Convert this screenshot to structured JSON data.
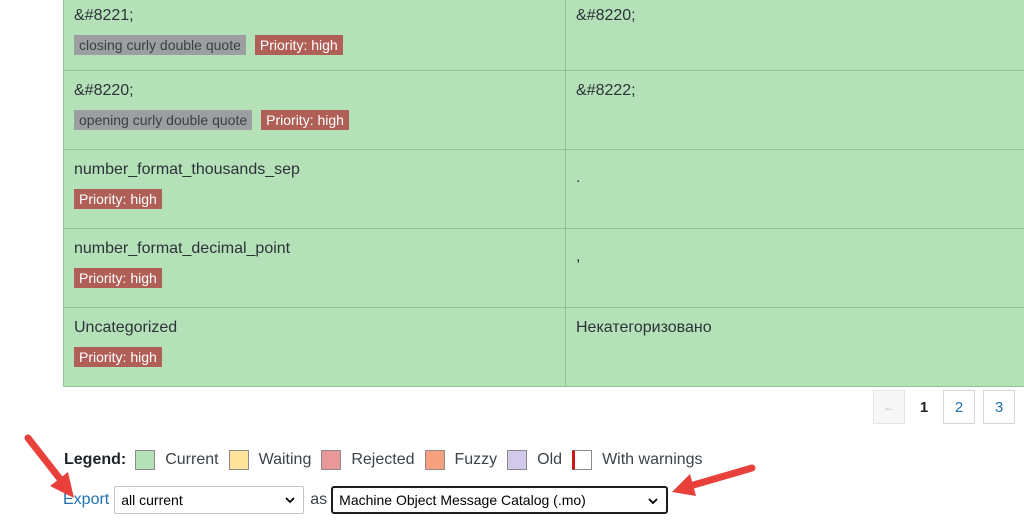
{
  "rows": [
    {
      "original": "&#8221;",
      "context": "closing curly double quote",
      "priority": "Priority: high",
      "translation": "&#8220;"
    },
    {
      "original": "&#8220;",
      "context": "opening curly double quote",
      "priority": "Priority: high",
      "translation": "&#8222;"
    },
    {
      "original": "number_format_thousands_sep",
      "priority": "Priority: high",
      "translation": "."
    },
    {
      "original": "number_format_decimal_point",
      "priority": "Priority: high",
      "translation": ","
    },
    {
      "original": "Uncategorized",
      "priority": "Priority: high",
      "translation": "Некатегоризовано"
    }
  ],
  "pagination": {
    "prev": "←",
    "current": "1",
    "pages": [
      "2",
      "3"
    ]
  },
  "legend": {
    "label": "Legend:",
    "items": [
      {
        "label": "Current",
        "color": "#b4e1b7"
      },
      {
        "label": "Waiting",
        "color": "#ffe399"
      },
      {
        "label": "Rejected",
        "color": "#e99797"
      },
      {
        "label": "Fuzzy",
        "color": "#f5a07e"
      },
      {
        "label": "Old",
        "color": "#d3c9ea"
      },
      {
        "label": "With warnings",
        "color": "#ffffff"
      }
    ]
  },
  "export": {
    "link": "Export",
    "filter_value": "all current",
    "as_label": "as",
    "format_value": "Machine Object Message Catalog (.mo)"
  },
  "colors": {
    "arrow": "#e8413b",
    "link": "#2271b1"
  }
}
